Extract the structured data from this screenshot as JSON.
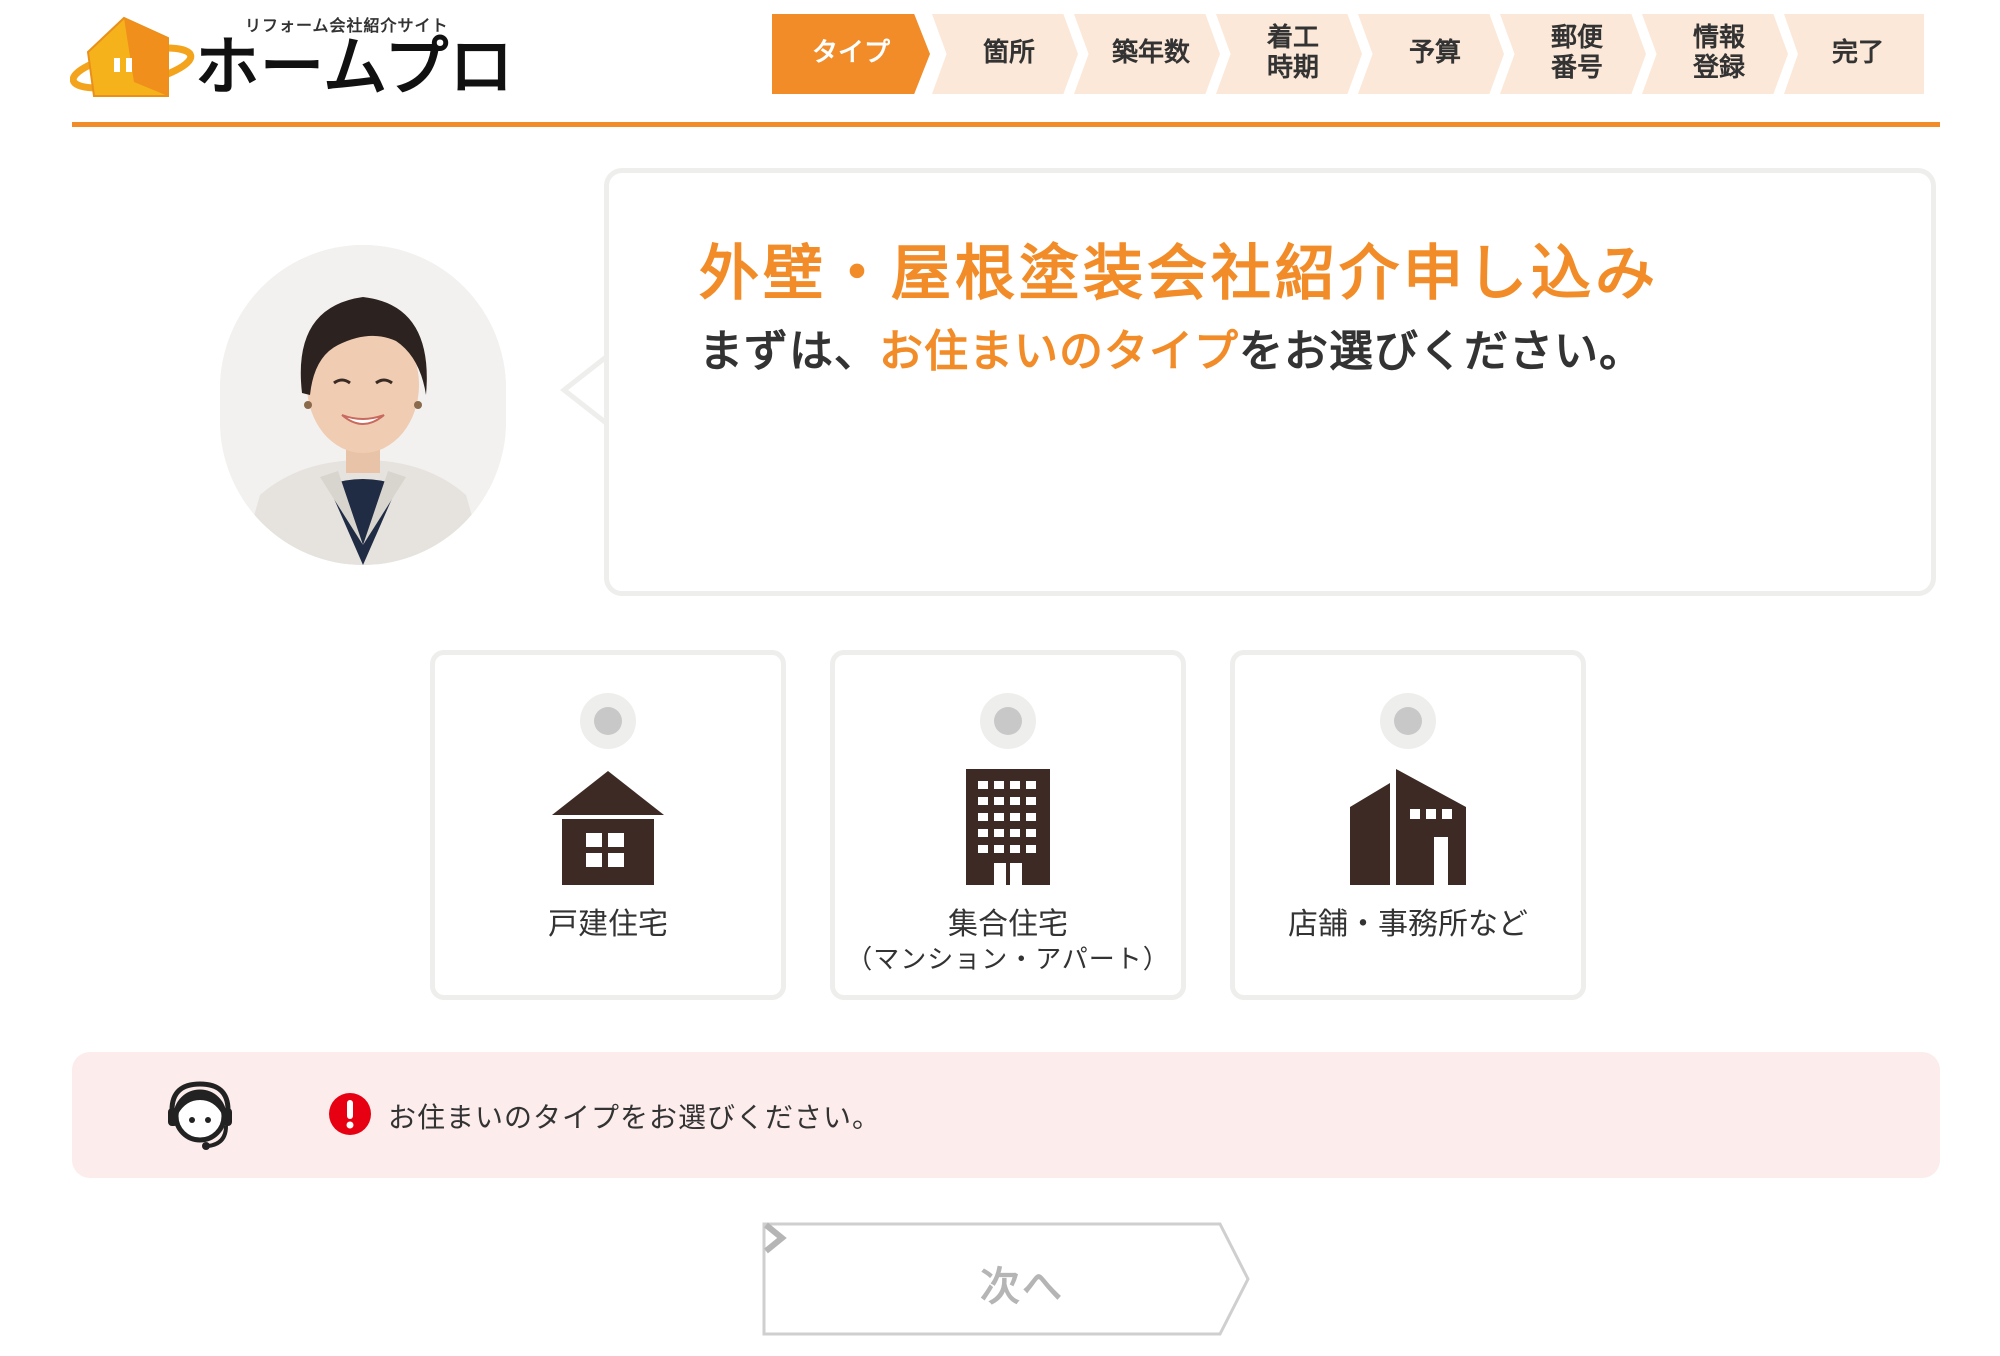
{
  "header": {
    "logo_tagline": "リフォーム会社紹介サイト",
    "logo_name": "ホームプロ"
  },
  "steps": [
    {
      "label": "タイプ",
      "active": true
    },
    {
      "label": "箇所",
      "active": false
    },
    {
      "label": "築年数",
      "active": false
    },
    {
      "label": "着工\n時期",
      "active": false
    },
    {
      "label": "予算",
      "active": false
    },
    {
      "label": "郵便\n番号",
      "active": false
    },
    {
      "label": "情報\n登録",
      "active": false
    },
    {
      "label": "完了",
      "active": false
    }
  ],
  "intro": {
    "title": "外壁・屋根塗装会社紹介申し込み",
    "subtitle_before": "まずは、",
    "subtitle_highlight": "お住まいのタイプ",
    "subtitle_after": "をお選びください。"
  },
  "options": [
    {
      "label": "戸建住宅",
      "sublabel": "",
      "icon": "house-icon",
      "selected": false
    },
    {
      "label": "集合住宅",
      "sublabel": "（マンション・アパート）",
      "icon": "apartment-building-icon",
      "selected": false
    },
    {
      "label": "店舗・事務所など",
      "sublabel": "",
      "icon": "store-office-icon",
      "selected": false
    }
  ],
  "alert": {
    "message": "お住まいのタイプをお選びください。",
    "icon": "headset-operator-icon",
    "status_icon": "exclamation-icon"
  },
  "next_button": {
    "label": "次へ",
    "enabled": false
  },
  "colors": {
    "accent": "#f28c28",
    "step_inactive": "#fbe8d8",
    "icon_brown": "#3e2a24",
    "alert_bg": "#fcecec",
    "alert_red": "#e60012",
    "disabled_text": "#b5b5b5"
  }
}
